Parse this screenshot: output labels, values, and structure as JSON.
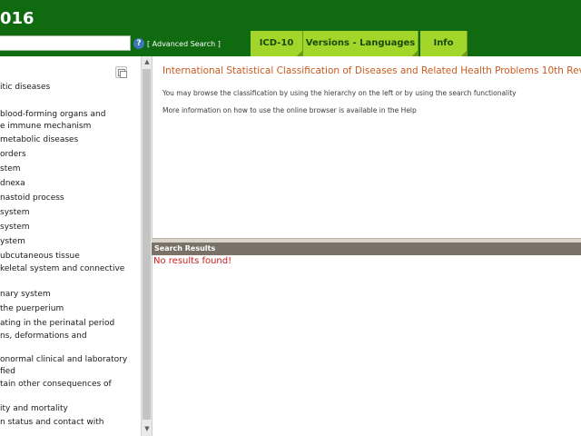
{
  "header": {
    "title": "016",
    "search_value": "",
    "advanced_search_label": "[ Advanced Search ]"
  },
  "tabs": [
    {
      "label": "ICD-10"
    },
    {
      "label": "Versions - Languages"
    },
    {
      "label": "Info"
    }
  ],
  "tree": {
    "items": [
      "itic diseases",
      "blood-forming organs and",
      "e immune mechanism",
      "metabolic diseases",
      "orders",
      "stem",
      "dnexa",
      "nastoid process",
      "system",
      "system",
      "ystem",
      "ubcutaneous tissue",
      "keletal system and connective",
      "nary system",
      "the puerperium",
      "ating in the perinatal period",
      "ns, deformations and",
      "onormal clinical and laboratory",
      "fied",
      "tain other consequences of",
      "ity and mortality",
      "n status and contact with"
    ]
  },
  "main": {
    "title": "International Statistical Classification of Diseases and Related Health Problems 10th Revi",
    "intro_line1": "You may browse the classification by using the hierarchy on the left or by using the search functionality",
    "intro_line2": "More information on how to use the online browser is available in the Help"
  },
  "results": {
    "header": "Search Results",
    "empty_message": "No results found!"
  },
  "colors": {
    "header_bg": "#0f6a10",
    "tab_bg": "#a3d62a",
    "title_color": "#c85a20",
    "no_results_color": "#cc1f1f"
  }
}
